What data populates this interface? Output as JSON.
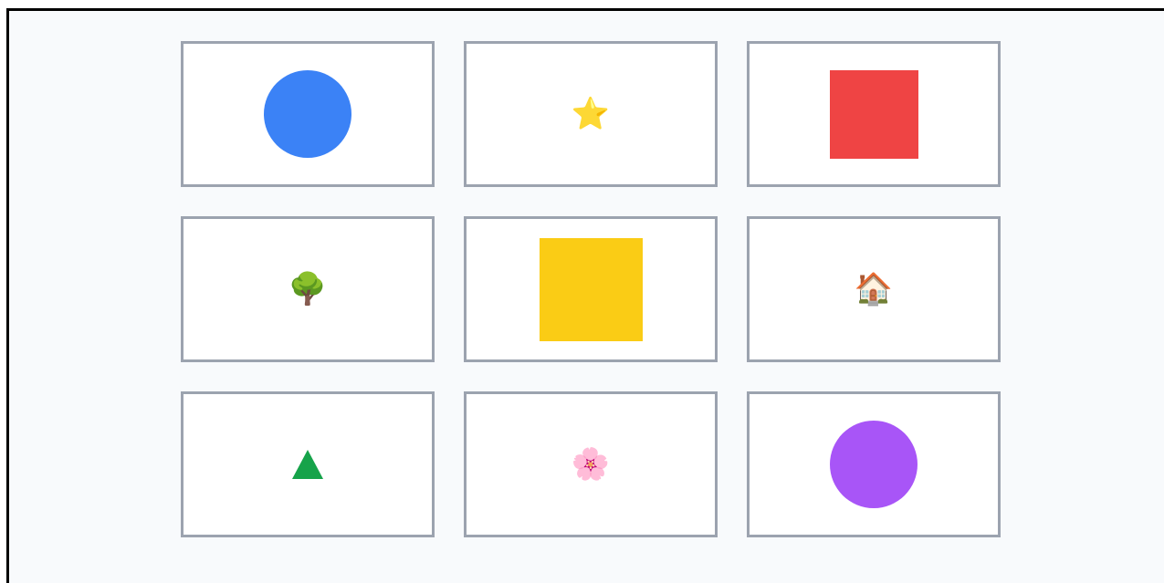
{
  "cards": [
    {
      "item": "circle",
      "color": "#3b82f6",
      "icon": "blue-circle-icon"
    },
    {
      "item": "star",
      "glyph": "⭐",
      "icon": "star-icon"
    },
    {
      "item": "square",
      "color": "#ef4444",
      "icon": "red-square-icon"
    },
    {
      "item": "tree",
      "glyph": "🌳",
      "icon": "tree-icon"
    },
    {
      "item": "square",
      "color": "#facc15",
      "icon": "yellow-square-icon"
    },
    {
      "item": "house",
      "glyph": "🏠",
      "icon": "house-icon"
    },
    {
      "item": "triangle",
      "color": "#16a34a",
      "icon": "green-triangle-icon"
    },
    {
      "item": "flower",
      "glyph": "🌸",
      "icon": "cherry-blossom-icon"
    },
    {
      "item": "circle",
      "color": "#a855f7",
      "icon": "purple-circle-icon"
    }
  ]
}
